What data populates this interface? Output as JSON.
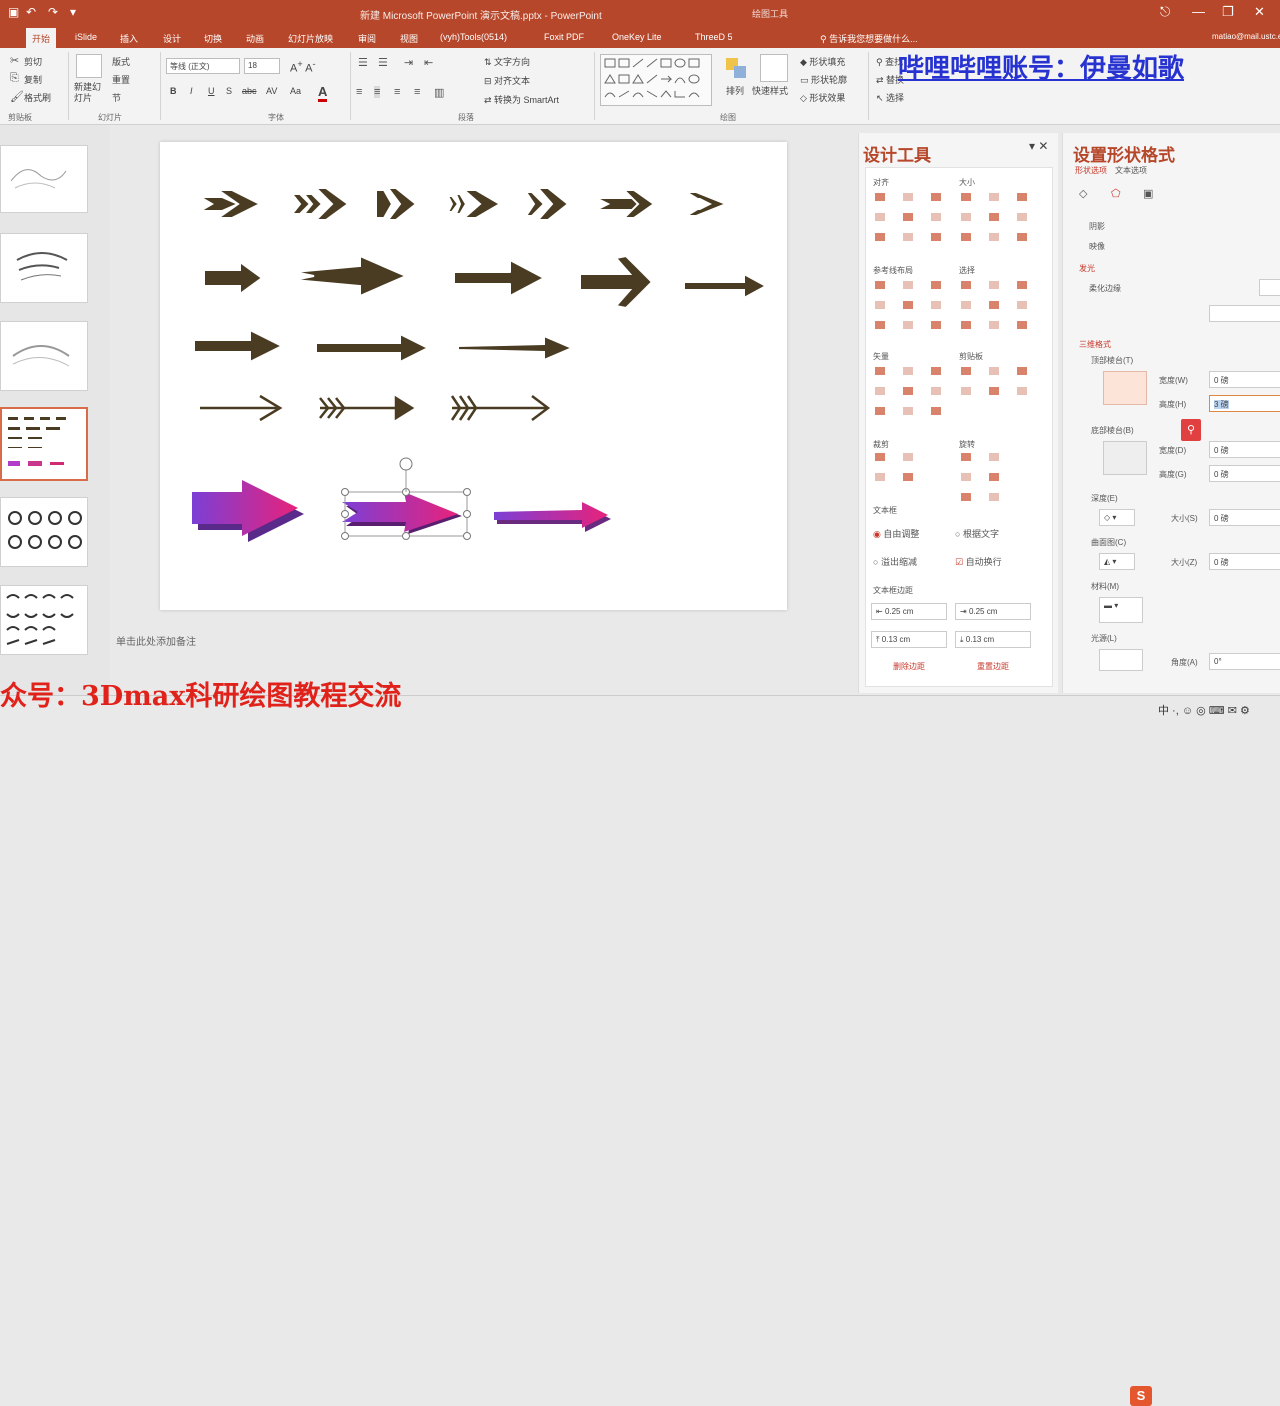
{
  "window": {
    "title": "新建 Microsoft PowerPoint 演示文稿.pptx - PowerPoint",
    "contextual_tab": "绘图工具"
  },
  "quick_access": [
    "↶",
    "↷",
    "▣",
    "▾"
  ],
  "window_controls": [
    "⎋",
    "—",
    "❐",
    "✕"
  ],
  "tabs": [
    "开始",
    "iSlide",
    "插入",
    "设计",
    "切换",
    "动画",
    "幻灯片放映",
    "审阅",
    "视图",
    "(vyh)Tools(0514)",
    "Foxit PDF",
    "OneKey Lite",
    "ThreeD 5"
  ],
  "tell_me": "告诉我您想要做什么...",
  "account": "matiao@mail.ustc.edu.cn",
  "ribbon": {
    "clipboard": {
      "cut": "剪切",
      "copy": "复制",
      "format_painter": "格式刷",
      "label": "剪贴板"
    },
    "slides": {
      "new_slide": "新建幻灯片",
      "layout": "版式",
      "reset": "重置",
      "section": "节",
      "label": "幻灯片"
    },
    "font": {
      "font_name": "等线 (正文)",
      "font_size": "18",
      "label": "字体",
      "buttons": [
        "B",
        "I",
        "U",
        "S",
        "abc",
        "AV",
        "Aa",
        "A"
      ]
    },
    "paragraph": {
      "text_direction": "文字方向",
      "align_text": "对齐文本",
      "smartart": "转换为 SmartArt",
      "label": "段落"
    },
    "drawing": {
      "arrange": "排列",
      "quick_styles": "快速样式",
      "shape_fill": "形状填充",
      "shape_outline": "形状轮廓",
      "shape_effects": "形状效果",
      "label": "绘图"
    },
    "editing": {
      "find": "查找",
      "replace": "替换",
      "select": "选择"
    }
  },
  "notes": {
    "placeholder": "单击此处添加备注"
  },
  "design_pane": {
    "title": "设计工具",
    "sections": {
      "align": "对齐",
      "size": "大小",
      "guides": "参考线布局",
      "select": "选择",
      "vector": "矢量",
      "clip": "剪贴板",
      "crop": "裁剪",
      "rotate": "旋转",
      "textbox": "文本框",
      "margins": "文本框边距"
    },
    "opt_autofit": "自由调整",
    "opt_fit_text": "根据文字",
    "opt_overflow": "溢出缩减",
    "opt_wrap": "自动换行",
    "margin_values": [
      "0.25 cm",
      "0.25 cm",
      "0.13 cm",
      "0.13 cm"
    ],
    "btn_remove": "删除边距",
    "btn_reset": "重置边距"
  },
  "format_pane": {
    "title": "设置形状格式",
    "subtabs": [
      "形状选项",
      "文本选项"
    ],
    "items": [
      "阴影",
      "映像",
      "发光",
      "柔化边缘",
      "三维格式",
      "顶部棱台(T)",
      "宽度(W)",
      "高度(H)",
      "底部棱台(B)",
      "宽度(D)",
      "高度(G)",
      "深度(E)",
      "大小(S)",
      "曲面图(C)",
      "大小(Z)",
      "材料(M)",
      "光源(L)",
      "角度(A)"
    ],
    "values": {
      "top_width": "0 磅",
      "top_height": "3 磅",
      "bottom_width": "0 磅",
      "bottom_height": "0 磅",
      "depth": "0 磅",
      "contour": "0 磅",
      "angle": "0°"
    }
  },
  "watermarks": {
    "top": "哔哩哔哩账号：伊曼如歌",
    "bottom": "众号：3Dmax科研绘图教程交流"
  },
  "colors": {
    "accent": "#b7472a",
    "arrow": "#4a3c23",
    "grad_a": "#7b3fd6",
    "grad_b": "#e8227b"
  }
}
